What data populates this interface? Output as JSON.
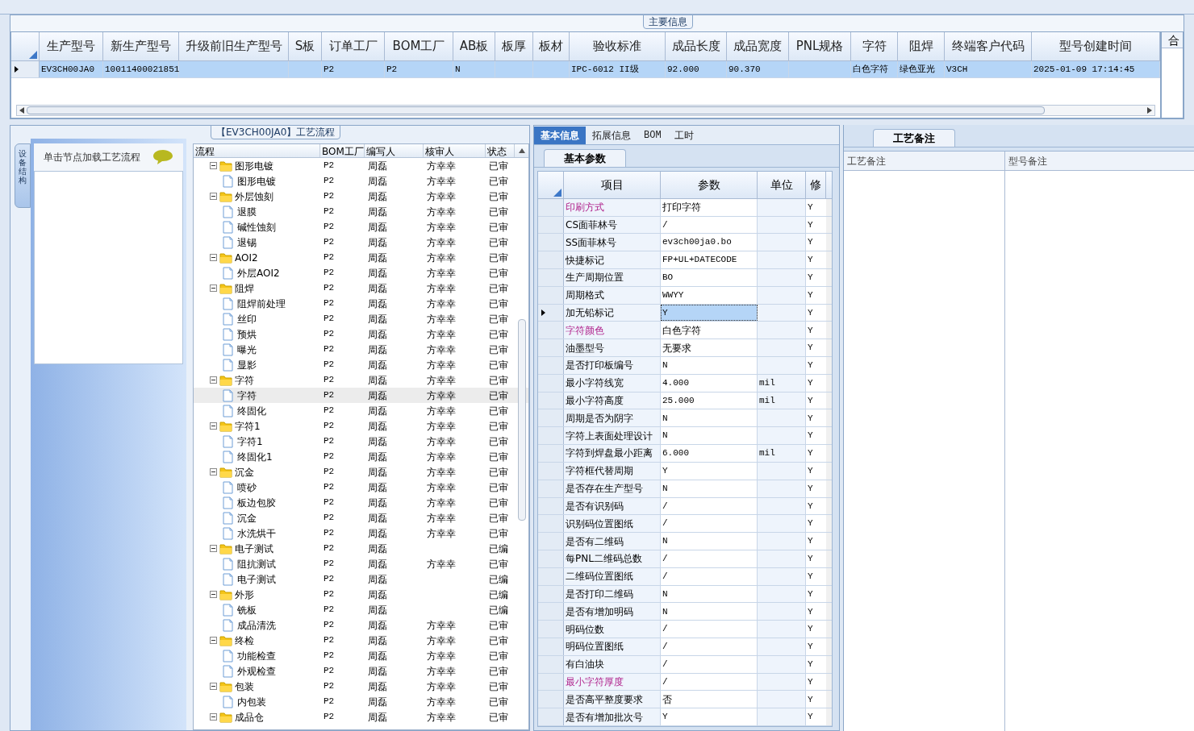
{
  "main_info": {
    "title": "主要信息",
    "columns": [
      "生产型号",
      "新生产型号",
      "升级前旧生产型号",
      "S板",
      "订单工厂",
      "BOM工厂",
      "AB板",
      "板厚",
      "板材",
      "验收标准",
      "成品长度",
      "成品宽度",
      "PNL规格",
      "字符",
      "阻焊",
      "终端客户代码",
      "型号创建时间"
    ],
    "rows": [
      {
        "selected": true,
        "cells": [
          "EV3CH00JA0",
          "10011400021851",
          null,
          null,
          "P2",
          "P2",
          "N",
          null,
          null,
          "IPC-6012 II级",
          "92.000",
          "90.370",
          null,
          "白色字符",
          "绿色亚光",
          "V3CH",
          "2025-01-09 17:14:45"
        ]
      }
    ],
    "side_panel_title": "合"
  },
  "process": {
    "title": "【EV3CH00JA0】工艺流程",
    "side_tab": "设备结构",
    "hint": "单击节点加载工艺流程",
    "columns": [
      "流程",
      "BOM工厂",
      "编写人",
      "核审人",
      "状态"
    ],
    "tree": [
      {
        "name": "图形电镀",
        "bom": "P2",
        "writer": "周磊",
        "reviewer": "方幸幸",
        "status": "已审",
        "expanded": true,
        "children": [
          {
            "name": "图形电镀",
            "bom": "P2",
            "writer": "周磊",
            "reviewer": "方幸幸",
            "status": "已审",
            "selected": false
          }
        ]
      },
      {
        "name": "外层蚀刻",
        "bom": "P2",
        "writer": "周磊",
        "reviewer": "方幸幸",
        "status": "已审",
        "expanded": true,
        "children": [
          {
            "name": "退膜",
            "bom": "P2",
            "writer": "周磊",
            "reviewer": "方幸幸",
            "status": "已审",
            "selected": false
          },
          {
            "name": "碱性蚀刻",
            "bom": "P2",
            "writer": "周磊",
            "reviewer": "方幸幸",
            "status": "已审",
            "selected": false
          },
          {
            "name": "退锡",
            "bom": "P2",
            "writer": "周磊",
            "reviewer": "方幸幸",
            "status": "已审",
            "selected": false
          }
        ]
      },
      {
        "name": "AOI2",
        "bom": "P2",
        "writer": "周磊",
        "reviewer": "方幸幸",
        "status": "已审",
        "expanded": true,
        "children": [
          {
            "name": "外层AOI2",
            "bom": "P2",
            "writer": "周磊",
            "reviewer": "方幸幸",
            "status": "已审",
            "selected": false
          }
        ]
      },
      {
        "name": "阻焊",
        "bom": "P2",
        "writer": "周磊",
        "reviewer": "方幸幸",
        "status": "已审",
        "expanded": true,
        "children": [
          {
            "name": "阻焊前处理",
            "bom": "P2",
            "writer": "周磊",
            "reviewer": "方幸幸",
            "status": "已审",
            "selected": false
          },
          {
            "name": "丝印",
            "bom": "P2",
            "writer": "周磊",
            "reviewer": "方幸幸",
            "status": "已审",
            "selected": false
          },
          {
            "name": "预烘",
            "bom": "P2",
            "writer": "周磊",
            "reviewer": "方幸幸",
            "status": "已审",
            "selected": false
          },
          {
            "name": "曝光",
            "bom": "P2",
            "writer": "周磊",
            "reviewer": "方幸幸",
            "status": "已审",
            "selected": false
          },
          {
            "name": "显影",
            "bom": "P2",
            "writer": "周磊",
            "reviewer": "方幸幸",
            "status": "已审",
            "selected": false
          }
        ]
      },
      {
        "name": "字符",
        "bom": "P2",
        "writer": "周磊",
        "reviewer": "方幸幸",
        "status": "已审",
        "expanded": true,
        "children": [
          {
            "name": "字符",
            "bom": "P2",
            "writer": "周磊",
            "reviewer": "方幸幸",
            "status": "已审",
            "selected": true
          },
          {
            "name": "终固化",
            "bom": "P2",
            "writer": "周磊",
            "reviewer": "方幸幸",
            "status": "已审",
            "selected": false
          }
        ]
      },
      {
        "name": "字符1",
        "bom": "P2",
        "writer": "周磊",
        "reviewer": "方幸幸",
        "status": "已审",
        "expanded": true,
        "children": [
          {
            "name": "字符1",
            "bom": "P2",
            "writer": "周磊",
            "reviewer": "方幸幸",
            "status": "已审",
            "selected": false
          },
          {
            "name": "终固化1",
            "bom": "P2",
            "writer": "周磊",
            "reviewer": "方幸幸",
            "status": "已审",
            "selected": false
          }
        ]
      },
      {
        "name": "沉金",
        "bom": "P2",
        "writer": "周磊",
        "reviewer": "方幸幸",
        "status": "已审",
        "expanded": true,
        "children": [
          {
            "name": "喷砂",
            "bom": "P2",
            "writer": "周磊",
            "reviewer": "方幸幸",
            "status": "已审",
            "selected": false
          },
          {
            "name": "板边包胶",
            "bom": "P2",
            "writer": "周磊",
            "reviewer": "方幸幸",
            "status": "已审",
            "selected": false
          },
          {
            "name": "沉金",
            "bom": "P2",
            "writer": "周磊",
            "reviewer": "方幸幸",
            "status": "已审",
            "selected": false
          },
          {
            "name": "水洗烘干",
            "bom": "P2",
            "writer": "周磊",
            "reviewer": "方幸幸",
            "status": "已审",
            "selected": false
          }
        ]
      },
      {
        "name": "电子测试",
        "bom": "P2",
        "writer": "周磊",
        "status": "已编",
        "expanded": true,
        "children": [
          {
            "name": "阻抗测试",
            "bom": "P2",
            "writer": "周磊",
            "reviewer": "方幸幸",
            "status": "已审",
            "selected": false
          },
          {
            "name": "电子测试",
            "bom": "P2",
            "writer": "周磊",
            "status": "已编",
            "selected": false
          }
        ]
      },
      {
        "name": "外形",
        "bom": "P2",
        "writer": "周磊",
        "status": "已编",
        "expanded": true,
        "children": [
          {
            "name": "铣板",
            "bom": "P2",
            "writer": "周磊",
            "status": "已编",
            "selected": false
          },
          {
            "name": "成品清洗",
            "bom": "P2",
            "writer": "周磊",
            "reviewer": "方幸幸",
            "status": "已审",
            "selected": false
          }
        ]
      },
      {
        "name": "终检",
        "bom": "P2",
        "writer": "周磊",
        "reviewer": "方幸幸",
        "status": "已审",
        "expanded": true,
        "children": [
          {
            "name": "功能检查",
            "bom": "P2",
            "writer": "周磊",
            "reviewer": "方幸幸",
            "status": "已审",
            "selected": false
          },
          {
            "name": "外观检查",
            "bom": "P2",
            "writer": "周磊",
            "reviewer": "方幸幸",
            "status": "已审",
            "selected": false
          }
        ]
      },
      {
        "name": "包装",
        "bom": "P2",
        "writer": "周磊",
        "reviewer": "方幸幸",
        "status": "已审",
        "expanded": true,
        "children": [
          {
            "name": "内包装",
            "bom": "P2",
            "writer": "周磊",
            "reviewer": "方幸幸",
            "status": "已审",
            "selected": false
          }
        ]
      },
      {
        "name": "成品仓",
        "bom": "P2",
        "writer": "周磊",
        "reviewer": "方幸幸",
        "status": "已审",
        "expanded": true
      }
    ]
  },
  "detail_tabs": [
    {
      "label": "基本信息",
      "selected": true
    },
    {
      "label": "拓展信息",
      "selected": false
    },
    {
      "label": "BOM",
      "selected": false
    },
    {
      "label": "工时",
      "selected": false
    }
  ],
  "params": {
    "tab": "基本参数",
    "columns": [
      "项目",
      "参数",
      "单位",
      "修"
    ],
    "rows": [
      {
        "item": "印刷方式",
        "value": "打印字符",
        "flag": "Y",
        "highlight": true,
        "selected": false
      },
      {
        "item": "CS面菲林号",
        "value": "/",
        "flag": "Y",
        "highlight": false,
        "selected": false
      },
      {
        "item": "SS面菲林号",
        "value": "ev3ch00ja0.bo",
        "flag": "Y",
        "highlight": false,
        "selected": false
      },
      {
        "item": "快捷标记",
        "value": "FP+UL+DATECODE",
        "flag": "Y",
        "highlight": false,
        "selected": false
      },
      {
        "item": "生产周期位置",
        "value": "BO",
        "flag": "Y",
        "highlight": false,
        "selected": false
      },
      {
        "item": "周期格式",
        "value": "WWYY",
        "flag": "Y",
        "highlight": false,
        "selected": false
      },
      {
        "item": "加无铅标记",
        "value": "Y",
        "flag": "Y",
        "highlight": false,
        "selected": true
      },
      {
        "item": "字符颜色",
        "value": "白色字符",
        "flag": "Y",
        "highlight": true,
        "selected": false
      },
      {
        "item": "油墨型号",
        "value": "无要求",
        "flag": "Y",
        "highlight": false,
        "selected": false
      },
      {
        "item": "是否打印板编号",
        "value": "N",
        "flag": "Y",
        "highlight": false,
        "selected": false
      },
      {
        "item": "最小字符线宽",
        "value": "4.000",
        "unit": "mil",
        "flag": "Y",
        "highlight": false,
        "selected": false
      },
      {
        "item": "最小字符高度",
        "value": "25.000",
        "unit": "mil",
        "flag": "Y",
        "highlight": false,
        "selected": false
      },
      {
        "item": "周期是否为阴字",
        "value": "N",
        "flag": "Y",
        "highlight": false,
        "selected": false
      },
      {
        "item": "字符上表面处理设计",
        "value": "N",
        "flag": "Y",
        "highlight": false,
        "selected": false
      },
      {
        "item": "字符到焊盘最小距离",
        "value": "6.000",
        "unit": "mil",
        "flag": "Y",
        "highlight": false,
        "selected": false
      },
      {
        "item": "字符框代替周期",
        "value": "Y",
        "flag": "Y",
        "highlight": false,
        "selected": false
      },
      {
        "item": "是否存在生产型号",
        "value": "N",
        "flag": "Y",
        "highlight": false,
        "selected": false
      },
      {
        "item": "是否有识别码",
        "value": "/",
        "flag": "Y",
        "highlight": false,
        "selected": false
      },
      {
        "item": "识别码位置图纸",
        "value": "/",
        "flag": "Y",
        "highlight": false,
        "selected": false
      },
      {
        "item": "是否有二维码",
        "value": "N",
        "flag": "Y",
        "highlight": false,
        "selected": false
      },
      {
        "item": "每PNL二维码总数",
        "value": "/",
        "flag": "Y",
        "highlight": false,
        "selected": false
      },
      {
        "item": "二维码位置图纸",
        "value": "/",
        "flag": "Y",
        "highlight": false,
        "selected": false
      },
      {
        "item": "是否打印二维码",
        "value": "N",
        "flag": "Y",
        "highlight": false,
        "selected": false
      },
      {
        "item": "是否有增加明码",
        "value": "N",
        "flag": "Y",
        "highlight": false,
        "selected": false
      },
      {
        "item": "明码位数",
        "value": "/",
        "flag": "Y",
        "highlight": false,
        "selected": false
      },
      {
        "item": "明码位置图纸",
        "value": "/",
        "flag": "Y",
        "highlight": false,
        "selected": false
      },
      {
        "item": "有白油块",
        "value": "/",
        "flag": "Y",
        "highlight": false,
        "selected": false
      },
      {
        "item": "最小字符厚度",
        "value": "/",
        "flag": "Y",
        "highlight": true,
        "selected": false
      },
      {
        "item": "是否高平整度要求",
        "value": "否",
        "flag": "Y",
        "highlight": false,
        "selected": false
      },
      {
        "item": "是否有增加批次号",
        "value": "Y",
        "flag": "Y",
        "highlight": false,
        "selected": false
      }
    ]
  },
  "notes": {
    "tab": "工艺备注",
    "columns": [
      "工艺备注",
      "型号备注"
    ]
  }
}
